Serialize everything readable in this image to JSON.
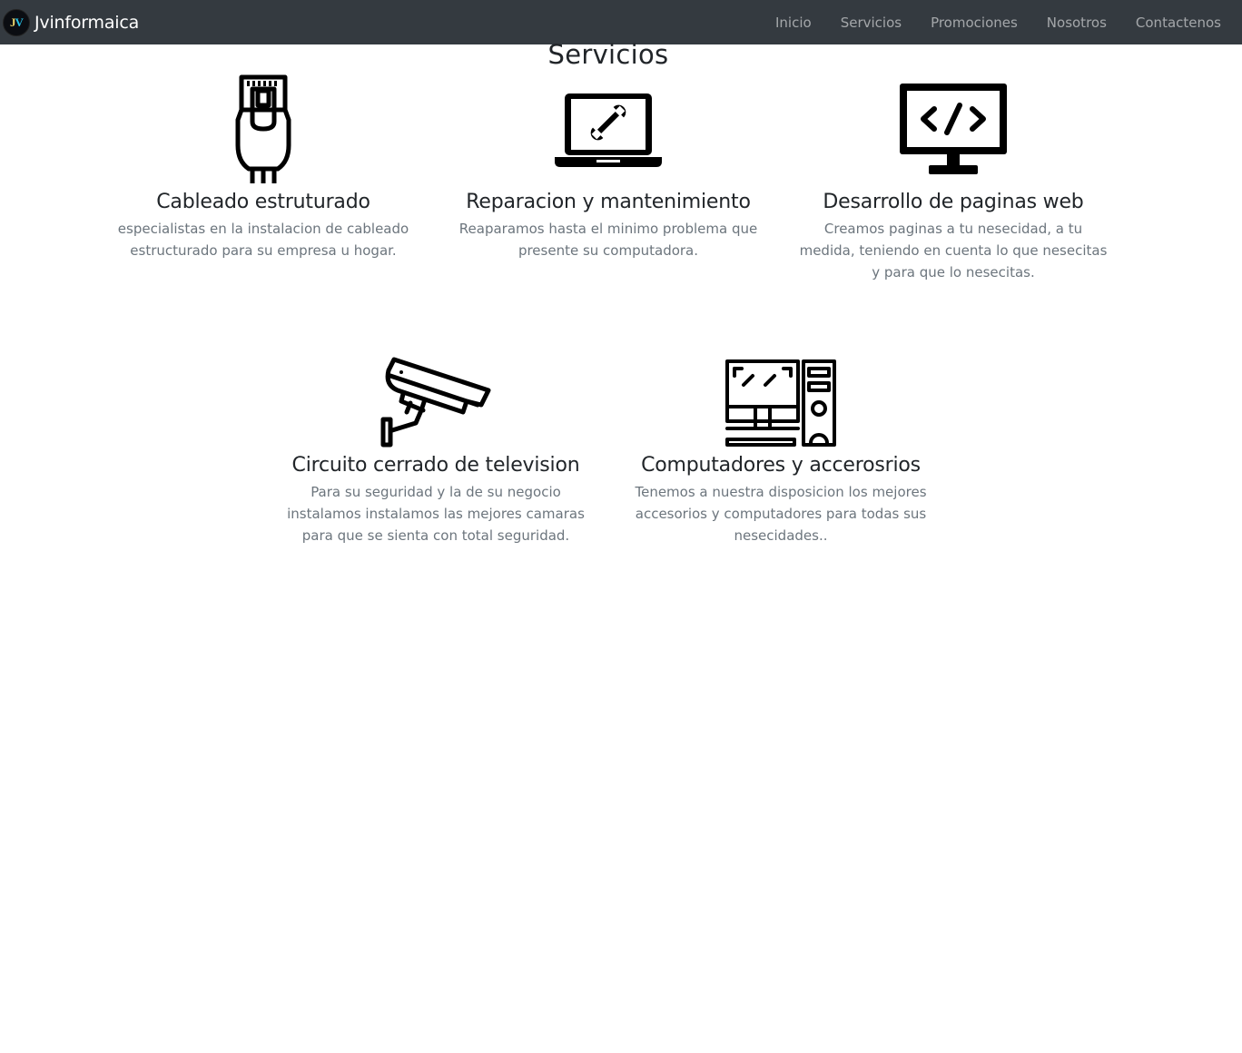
{
  "navbar": {
    "logo_text_1": "J",
    "logo_text_2": "V",
    "brand": "Jvinformaica",
    "links": [
      "Inicio",
      "Servicios",
      "Promociones",
      "Nosotros",
      "Contactenos"
    ]
  },
  "main": {
    "title": "Servicios",
    "services": [
      {
        "icon": "ethernet-cable-icon",
        "title": "Cableado estruturado",
        "description": "especialistas en la instalacion de cableado estructurado para su empresa u hogar."
      },
      {
        "icon": "laptop-repair-icon",
        "title": "Reparacion y mantenimiento",
        "description": "Reaparamos hasta el minimo problema que presente su computadora."
      },
      {
        "icon": "code-monitor-icon",
        "title": "Desarrollo de paginas web",
        "description": "Creamos paginas a tu nesecidad, a tu medida, teniendo en cuenta lo que nesecitas y para que lo nesecitas."
      },
      {
        "icon": "cctv-camera-icon",
        "title": "Circuito cerrado de television",
        "description": "Para su seguridad y la de su negocio instalamos instalamos las mejores camaras para que se sienta con total seguridad."
      },
      {
        "icon": "desktop-computer-icon",
        "title": "Computadores y accerosrios",
        "description": "Tenemos a nuestra disposicion los mejores accesorios y computadores para todas sus nesecidades.."
      }
    ]
  },
  "colors": {
    "navbar_bg": "#343a40",
    "text": "#212529",
    "muted": "#6c757d"
  }
}
